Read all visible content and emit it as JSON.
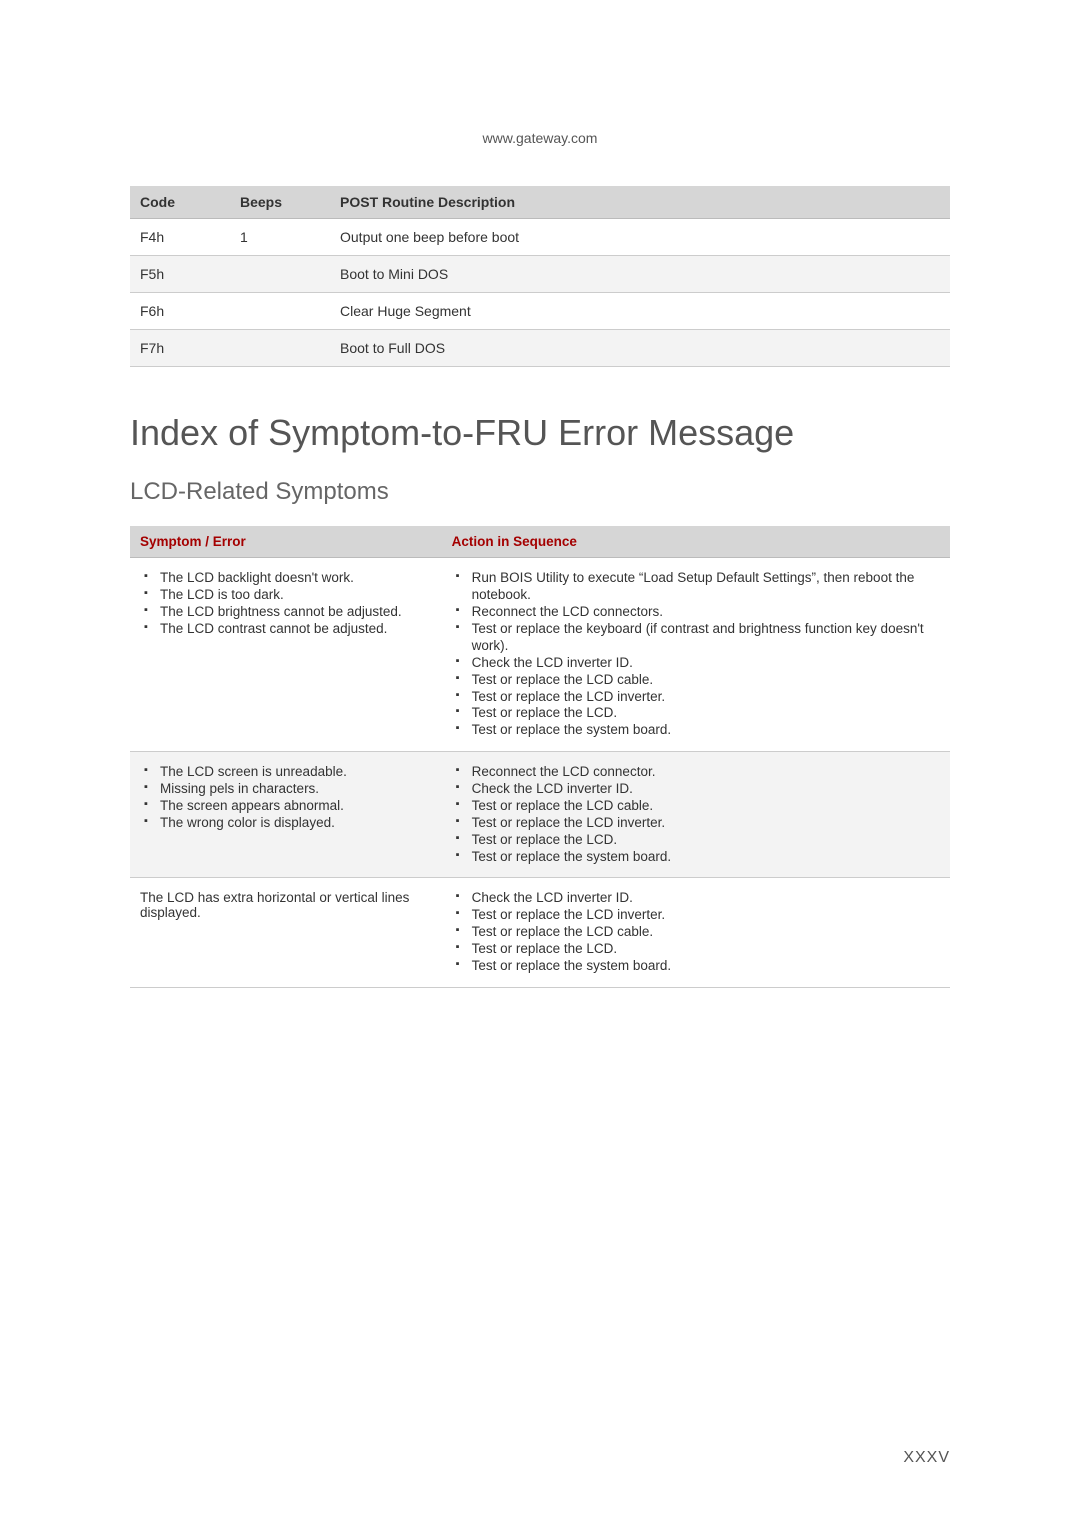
{
  "url": "www.gateway.com",
  "post_table": {
    "headers": {
      "code": "Code",
      "beeps": "Beeps",
      "desc": "POST Routine Description"
    },
    "rows": [
      {
        "code": "F4h",
        "beeps": "1",
        "desc": "Output one beep before boot"
      },
      {
        "code": "F5h",
        "beeps": "",
        "desc": "Boot to Mini DOS"
      },
      {
        "code": "F6h",
        "beeps": "",
        "desc": "Clear Huge Segment"
      },
      {
        "code": "F7h",
        "beeps": "",
        "desc": "Boot to Full DOS"
      }
    ]
  },
  "heading1": "Index of Symptom-to-FRU Error Message",
  "heading2": "LCD-Related Symptoms",
  "symptom_table": {
    "headers": {
      "symptom": "Symptom / Error",
      "action": "Action in Sequence"
    },
    "rows": [
      {
        "symptom_plain": "",
        "symptom_items": [
          "The LCD backlight doesn't work.",
          "The LCD is too dark.",
          "The LCD brightness cannot be adjusted.",
          "The LCD contrast cannot be adjusted."
        ],
        "action_items": [
          "Run BOIS Utility to execute “Load Setup Default Settings”, then reboot the notebook.",
          "Reconnect the LCD connectors.",
          "Test or replace the keyboard (if contrast and brightness function key doesn't work).",
          "Check the LCD inverter ID.",
          "Test or replace the LCD cable.",
          "Test or replace the LCD inverter.",
          "Test or replace the LCD.",
          "Test or replace the system board."
        ]
      },
      {
        "symptom_plain": "",
        "symptom_items": [
          "The LCD screen is unreadable.",
          "Missing pels in characters.",
          "The screen appears abnormal.",
          "The wrong color is displayed."
        ],
        "action_items": [
          "Reconnect the LCD connector.",
          "Check the LCD inverter ID.",
          "Test or replace the LCD cable.",
          "Test or replace the LCD inverter.",
          "Test or replace the LCD.",
          "Test or replace the system board."
        ]
      },
      {
        "symptom_plain": "The LCD has extra horizontal or vertical lines displayed.",
        "symptom_items": [],
        "action_items": [
          "Check the LCD inverter ID.",
          "Test or replace the LCD inverter.",
          "Test or replace the LCD cable.",
          "Test or replace the LCD.",
          "Test or replace the system board."
        ]
      }
    ]
  },
  "page_number": "XXXV"
}
